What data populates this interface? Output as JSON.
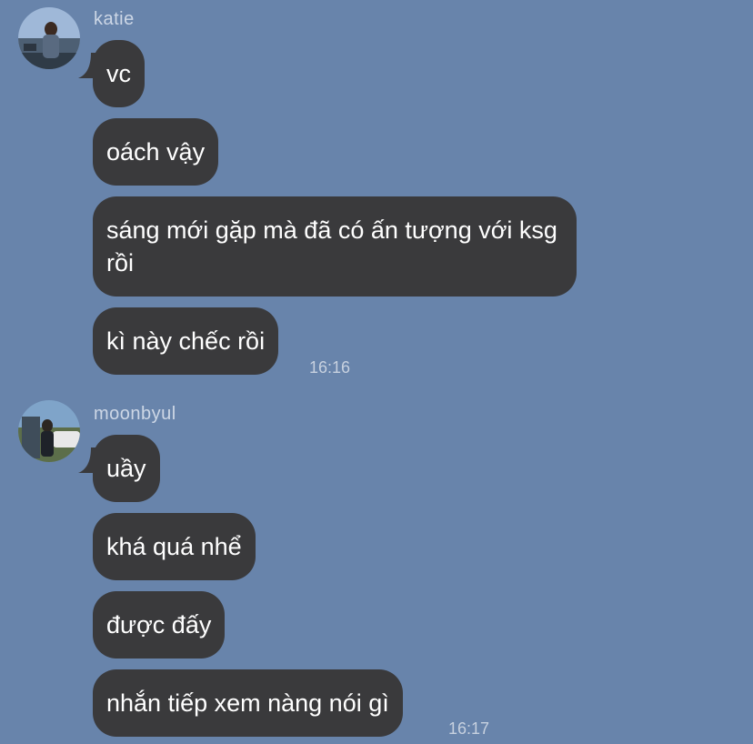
{
  "groups": [
    {
      "sender": "katie",
      "messages": [
        "vc",
        "oách vậy",
        "sáng mới gặp mà đã có ấn tượng với ksg rồi",
        "kì này chếc rồi"
      ],
      "time": "16:16"
    },
    {
      "sender": "moonbyul",
      "messages": [
        "uầy",
        "khá quá nhể",
        "được đấy",
        "nhắn tiếp xem nàng nói gì"
      ],
      "time": "16:17"
    }
  ]
}
